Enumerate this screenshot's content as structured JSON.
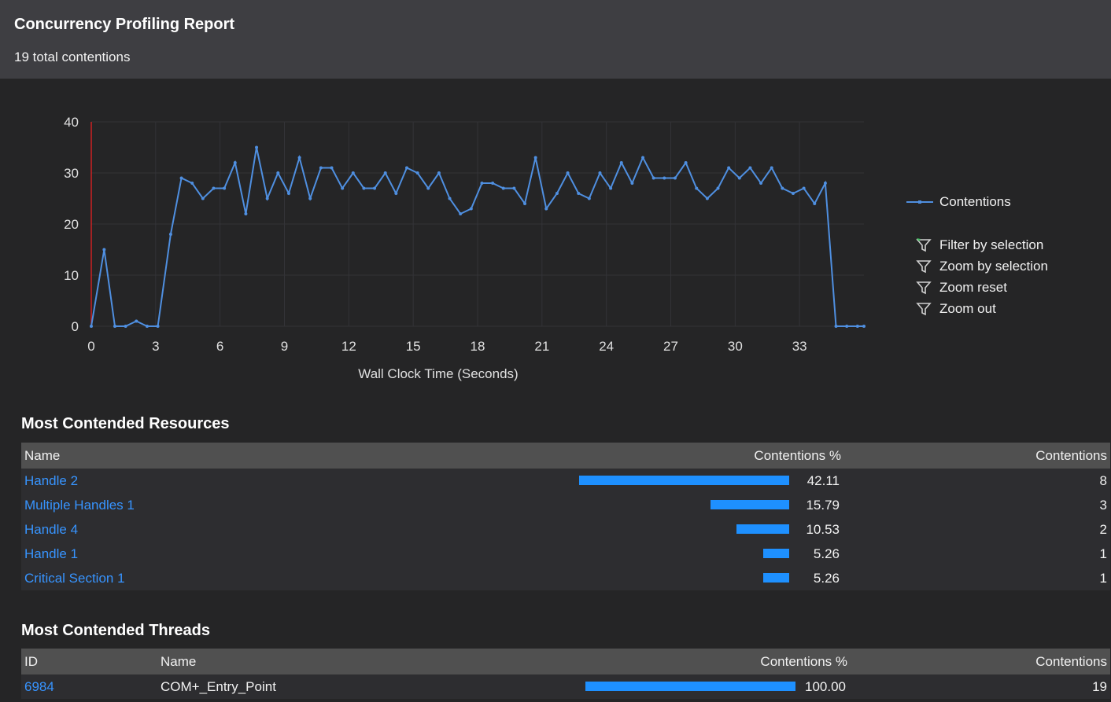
{
  "header": {
    "title": "Concurrency Profiling Report",
    "subtitle": "19 total contentions"
  },
  "colors": {
    "accent": "#1e90ff",
    "line": "#4f8fe0",
    "marker": "#cc2222",
    "link": "#3794ff"
  },
  "chart_data": {
    "type": "line",
    "xlabel": "Wall Clock Time (Seconds)",
    "ylabel": "",
    "xlim": [
      0,
      36
    ],
    "ylim": [
      0,
      40
    ],
    "x_ticks": [
      "0",
      "3",
      "6",
      "9",
      "12",
      "15",
      "18",
      "21",
      "24",
      "27",
      "30",
      "33"
    ],
    "y_ticks": [
      "0",
      "10",
      "20",
      "30",
      "40"
    ],
    "grid": true,
    "legend": "right",
    "series": [
      {
        "name": "Contentions",
        "x": [
          0,
          0.6,
          1.1,
          1.6,
          2.1,
          2.6,
          3.1,
          3.7,
          4.2,
          4.7,
          5.2,
          5.7,
          6.2,
          6.7,
          7.2,
          7.7,
          8.2,
          8.7,
          9.2,
          9.7,
          10.2,
          10.7,
          11.2,
          11.7,
          12.2,
          12.7,
          13.2,
          13.7,
          14.2,
          14.7,
          15.2,
          15.7,
          16.2,
          16.7,
          17.2,
          17.7,
          18.2,
          18.7,
          19.2,
          19.7,
          20.2,
          20.7,
          21.2,
          21.7,
          22.2,
          22.7,
          23.2,
          23.7,
          24.2,
          24.7,
          25.2,
          25.7,
          26.2,
          26.7,
          27.2,
          27.7,
          28.2,
          28.7,
          29.2,
          29.7,
          30.2,
          30.7,
          31.2,
          31.7,
          32.2,
          32.7,
          33.2,
          33.7,
          34.2,
          34.7,
          35.2,
          35.7,
          36.0
        ],
        "values": [
          0,
          15,
          0,
          0,
          1,
          0,
          0,
          18,
          29,
          28,
          25,
          27,
          27,
          32,
          22,
          35,
          25,
          30,
          26,
          33,
          25,
          31,
          31,
          27,
          30,
          27,
          27,
          30,
          26,
          31,
          30,
          27,
          30,
          25,
          22,
          23,
          28,
          28,
          27,
          27,
          24,
          33,
          23,
          26,
          30,
          26,
          25,
          30,
          27,
          32,
          28,
          33,
          29,
          29,
          29,
          32,
          27,
          25,
          27,
          31,
          29,
          31,
          28,
          31,
          27,
          26,
          27,
          24,
          28,
          0,
          0,
          0,
          0
        ]
      }
    ],
    "legend_actions": [
      "Filter by selection",
      "Zoom by selection",
      "Zoom reset",
      "Zoom out"
    ]
  },
  "resources": {
    "title": "Most Contended Resources",
    "columns": [
      "Name",
      "Contentions %",
      "Contentions"
    ],
    "rows": [
      {
        "name": "Handle 2",
        "pct": "42.11",
        "pct_value": 42.11,
        "count": "8"
      },
      {
        "name": "Multiple Handles 1",
        "pct": "15.79",
        "pct_value": 15.79,
        "count": "3"
      },
      {
        "name": "Handle 4",
        "pct": "10.53",
        "pct_value": 10.53,
        "count": "2"
      },
      {
        "name": "Handle 1",
        "pct": "5.26",
        "pct_value": 5.26,
        "count": "1"
      },
      {
        "name": "Critical Section 1",
        "pct": "5.26",
        "pct_value": 5.26,
        "count": "1"
      }
    ]
  },
  "threads": {
    "title": "Most Contended Threads",
    "columns": [
      "ID",
      "Name",
      "Contentions %",
      "Contentions"
    ],
    "rows": [
      {
        "id": "6984",
        "name": "COM+_Entry_Point",
        "pct": "100.00",
        "pct_value": 100.0,
        "count": "19"
      }
    ]
  }
}
